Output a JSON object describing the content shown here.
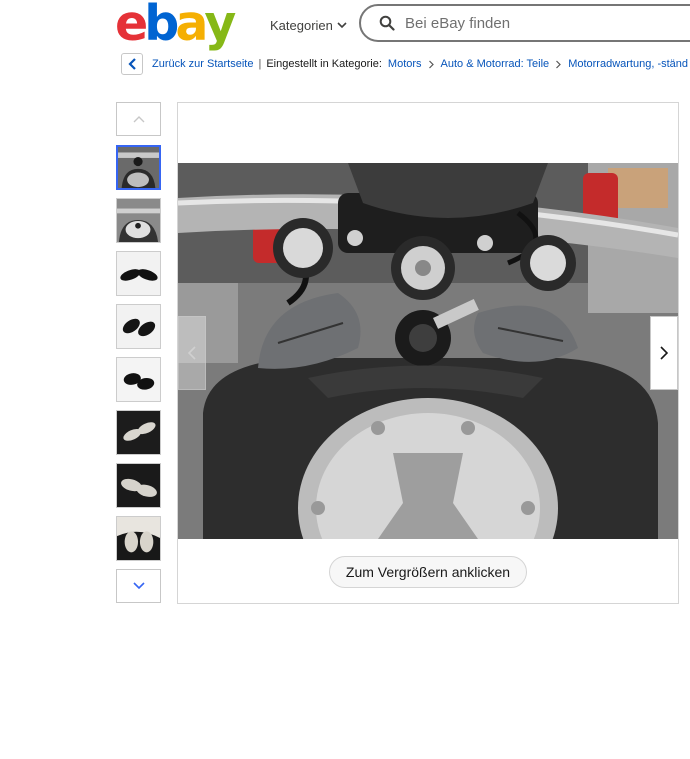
{
  "header": {
    "logo_text": "ebay",
    "categories_label": "Kategorien",
    "search_placeholder": "Bei eBay finden"
  },
  "breadcrumb": {
    "back_label": "Zurück zur Startseite",
    "separator": "|",
    "category_prefix": "Eingestellt in Kategorie:",
    "items": [
      "Motors",
      "Auto & Motorrad: Teile",
      "Motorradwartung, -ständ"
    ]
  },
  "gallery": {
    "thumbnail_count": 8,
    "selected_index": 0,
    "zoom_label": "Zum Vergrößern anklicken"
  },
  "colors": {
    "accent": "#3665f3",
    "link": "#0654ba",
    "logo_e": "#e53238",
    "logo_b": "#0064d2",
    "logo_a": "#f5af02",
    "logo_y": "#86b817"
  },
  "icons": {
    "search": "search-icon",
    "categories": "chevron-down-icon",
    "back": "chevron-left-icon",
    "thumb_up": "chevron-up-icon",
    "thumb_down": "chevron-down-icon",
    "prev": "chevron-left-icon",
    "next": "chevron-right-icon"
  }
}
